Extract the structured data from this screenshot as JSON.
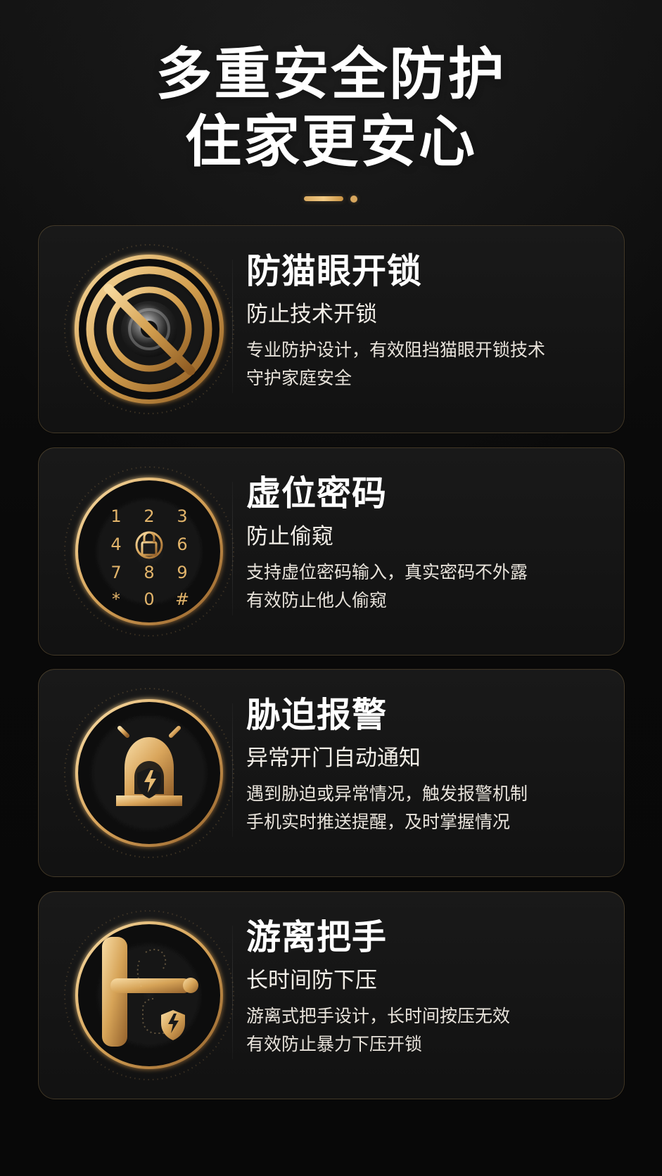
{
  "header": {
    "title_line_1": "多重安全防护",
    "title_line_2": "住家更安心"
  },
  "features": [
    {
      "title": "防猫眼开锁",
      "subtitle": "防止技术开锁",
      "description_line_1": "专业防护设计，有效阻挡猫眼开锁技术",
      "description_line_2": "守护家庭安全",
      "icon": "peephole-blocked-icon"
    },
    {
      "title": "虚位密码",
      "subtitle": "防止偷窥",
      "description_line_1": "支持虚位密码输入，真实密码不外露",
      "description_line_2": "有效防止他人偷窥",
      "icon": "keypad-lock-icon",
      "keypad": [
        "1",
        "2",
        "3",
        "4",
        "6",
        "7",
        "8",
        "9",
        "*",
        "0",
        "#"
      ]
    },
    {
      "title": "胁迫报警",
      "subtitle": "异常开门自动通知",
      "description_line_1": "遇到胁迫或异常情况，触发报警机制",
      "description_line_2": "手机实时推送提醒，及时掌握情况",
      "icon": "alarm-siren-icon"
    },
    {
      "title": "游离把手",
      "subtitle": "长时间防下压",
      "description_line_1": "游离式把手设计，长时间按压无效",
      "description_line_2": "有效防止暴力下压开锁",
      "icon": "door-handle-shield-icon"
    }
  ],
  "colors": {
    "background": "#0b0b0b",
    "card": "#171717",
    "gold": "#d8a75e",
    "gold_light": "#f4d18f",
    "white": "#ffffff"
  }
}
